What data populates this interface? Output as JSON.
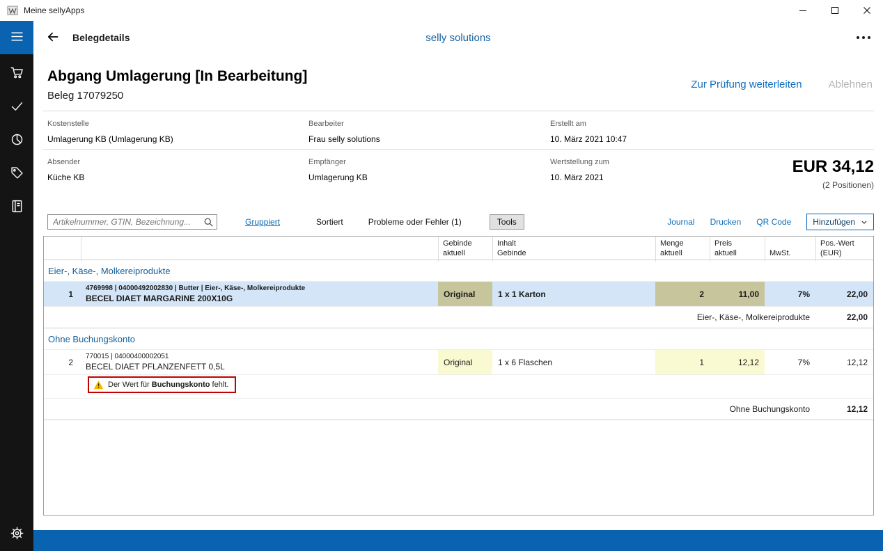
{
  "colors": {
    "accent_blue": "#0a63b1",
    "link_blue": "#0e6eb8",
    "selected_row": "#d3e5f7",
    "editable_cell_selected": "#c6c59b",
    "editable_cell": "#fafad2",
    "warning_border": "#c00000",
    "sidebar_bg": "#141414"
  },
  "icons": {
    "app": "selly-logo",
    "minimize": "minimize",
    "maximize": "maximize",
    "close": "close",
    "menu": "hamburger",
    "cart": "shopping-cart",
    "approve": "checkmark",
    "stats": "pie-chart",
    "tag": "price-tag",
    "journal": "book",
    "settings": "gear",
    "back": "arrow-left",
    "more": "ellipsis",
    "search": "magnifier",
    "dropdown": "chevron-down",
    "warning": "warning-triangle"
  },
  "window": {
    "title": "Meine sellyApps"
  },
  "appbar": {
    "title": "Belegdetails",
    "center_title": "selly solutions"
  },
  "document": {
    "title": "Abgang Umlagerung [In Bearbeitung]",
    "subtitle": "Beleg 17079250",
    "action_forward": "Zur Prüfung weiterleiten",
    "action_reject": "Ablehnen",
    "fields": {
      "kostenstelle_label": "Kostenstelle",
      "kostenstelle_value": "Umlagerung KB (Umlagerung KB)",
      "bearbeiter_label": "Bearbeiter",
      "bearbeiter_value": "Frau selly solutions",
      "erstellt_label": "Erstellt am",
      "erstellt_value": "10. März 2021 10:47",
      "absender_label": "Absender",
      "absender_value": "Küche KB",
      "empfaenger_label": "Empfänger",
      "empfaenger_value": "Umlagerung KB",
      "wertstellung_label": "Wertstellung zum",
      "wertstellung_value": "10. März 2021"
    },
    "total_amount": "EUR 34,12",
    "total_positions": "(2 Positionen)"
  },
  "toolbar": {
    "search_placeholder": "Artikelnummer, GTIN, Bezeichnung...",
    "grouped": "Gruppiert",
    "sorted": "Sortiert",
    "problems": "Probleme oder Fehler (1)",
    "tools": "Tools",
    "journal": "Journal",
    "print": "Drucken",
    "qr_code": "QR Code",
    "add": "Hinzufügen"
  },
  "table": {
    "headers": {
      "gebinde": "Gebinde\naktuell",
      "inhalt": "Inhalt\nGebinde",
      "menge": "Menge\naktuell",
      "preis": "Preis\naktuell",
      "mwst": "MwSt.",
      "wert": "Pos.-Wert\n(EUR)"
    },
    "groups": [
      {
        "name": "Eier-, Käse-, Molkereiprodukte",
        "rows": [
          {
            "num": "1",
            "meta": "4769998 | 04000492002830 | Butter | Eier-, Käse-, Molkereiprodukte",
            "name": "BECEL DIAET MARGARINE 200X10G",
            "gebinde": "Original",
            "inhalt": "1 x 1 Karton",
            "menge": "2",
            "preis": "11,00",
            "mwst": "7%",
            "wert": "22,00"
          }
        ],
        "subtotal_label": "Eier-, Käse-, Molkereiprodukte",
        "subtotal_value": "22,00"
      },
      {
        "name": "Ohne Buchungskonto",
        "rows": [
          {
            "num": "2",
            "meta": "770015 | 04000400002051",
            "name": "BECEL DIAET PFLANZENFETT 0,5L",
            "gebinde": "Original",
            "inhalt": "1 x 6 Flaschen",
            "menge": "1",
            "preis": "12,12",
            "mwst": "7%",
            "wert": "12,12",
            "warning_prefix": "Der Wert für ",
            "warning_field": "Buchungskonto",
            "warning_suffix": " fehlt."
          }
        ],
        "subtotal_label": "Ohne Buchungskonto",
        "subtotal_value": "12,12"
      }
    ]
  }
}
